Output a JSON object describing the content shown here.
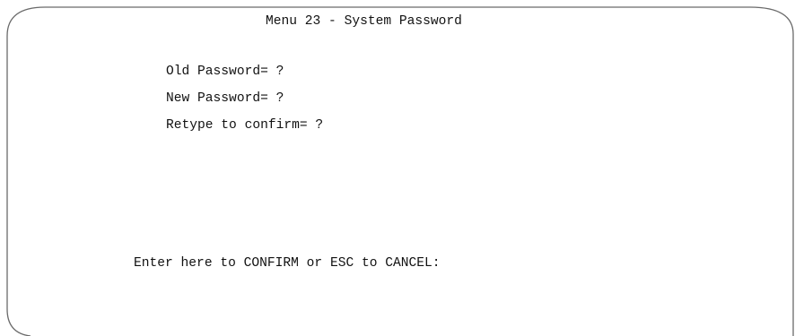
{
  "screen": {
    "title": "Menu 23 - System Password"
  },
  "fields": [
    {
      "label": "Old Password=",
      "value": "?"
    },
    {
      "label": "New Password=",
      "value": "?"
    },
    {
      "label": "Retype to confirm=",
      "value": "?"
    }
  ],
  "footer": {
    "prompt": "Enter here to CONFIRM or ESC to CANCEL:"
  }
}
